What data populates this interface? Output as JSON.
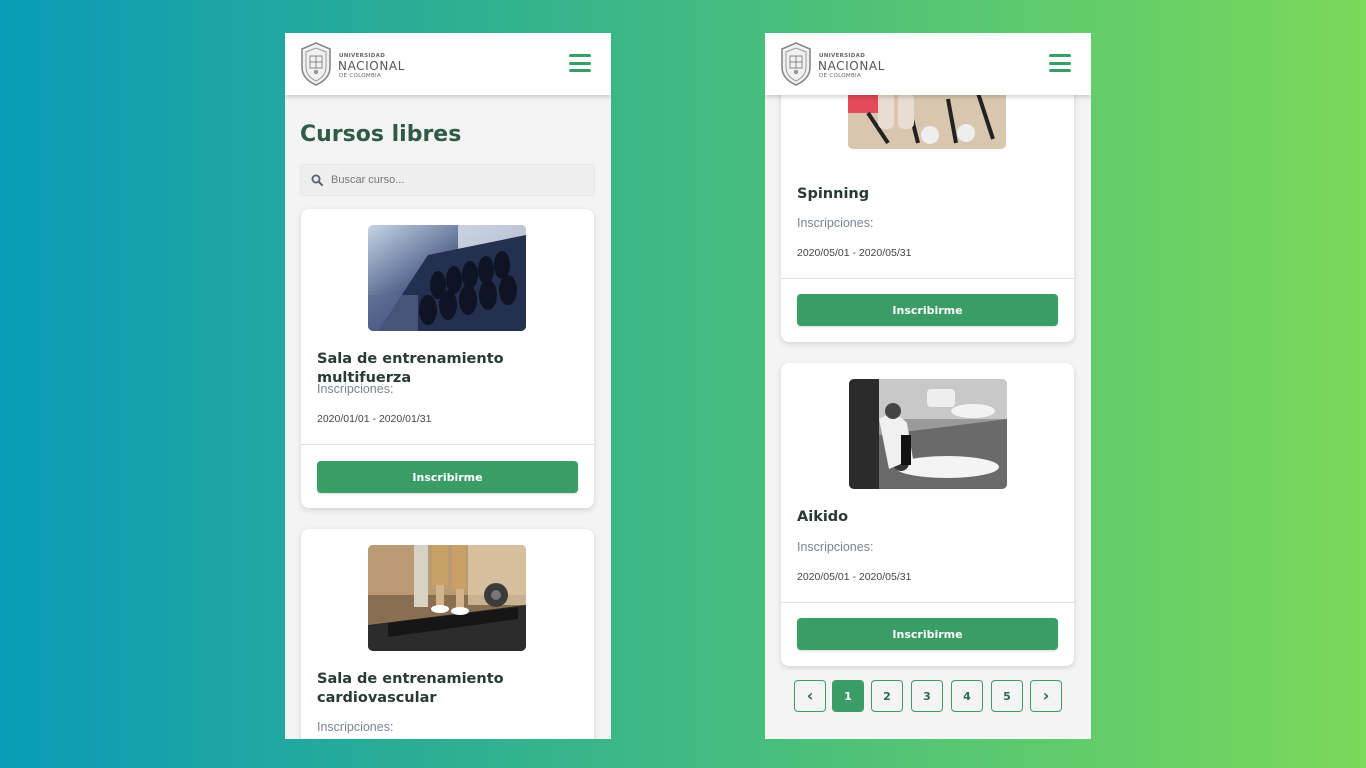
{
  "logo": {
    "line1": "UNIVERSIDAD",
    "line2": "NACIONAL",
    "line3": "DE COLOMBIA",
    "icon": "university-shield-icon"
  },
  "menu_icon": "hamburger-menu-icon",
  "left": {
    "title": "Cursos libres",
    "search_placeholder": "Buscar curso...",
    "cards": [
      {
        "title": "Sala de entrenamiento multifuerza",
        "label": "Inscripciones:",
        "dates": "2020/01/01 - 2020/01/31",
        "button": "Inscribirme",
        "image": "dumbbell-rack-photo"
      },
      {
        "title_line1": "Sala de entrenamiento",
        "title_line2": "cardiovascular",
        "label": "Inscripciones:",
        "image": "treadmill-photo"
      }
    ]
  },
  "right": {
    "cards": [
      {
        "title": "Spinning",
        "label": "Inscripciones:",
        "dates": "2020/05/01 - 2020/05/31",
        "button": "Inscribirme",
        "image": "spinning-bikes-photo"
      },
      {
        "title": "Aikido",
        "label": "Inscripciones:",
        "dates": "2020/05/01 - 2020/05/31",
        "button": "Inscribirme",
        "image": "aikido-photo"
      }
    ],
    "pagination": {
      "prev": "‹",
      "next": "›",
      "pages": [
        "1",
        "2",
        "3",
        "4",
        "5"
      ],
      "current": "1"
    }
  },
  "colors": {
    "primary": "#3a9d66",
    "title": "#2f5a44",
    "background": "#f4f4f4"
  }
}
